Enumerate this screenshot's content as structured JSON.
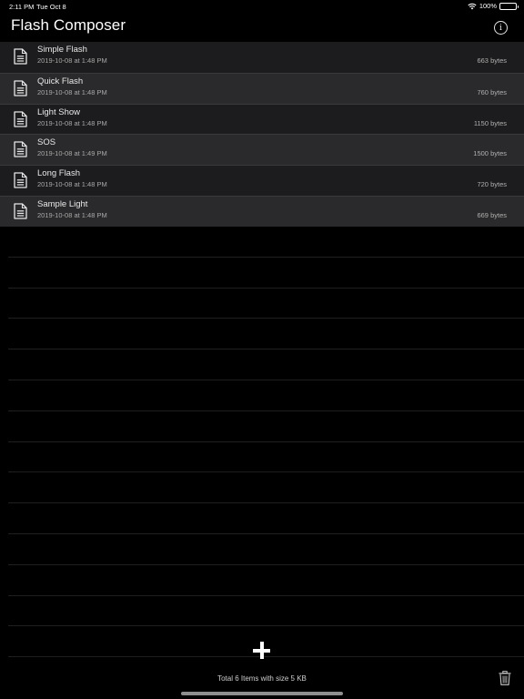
{
  "status_bar": {
    "time": "2:11 PM",
    "date": "Tue Oct 8",
    "battery": "100%"
  },
  "nav": {
    "title": "Flash Composer",
    "info_icon": "info-circle-icon",
    "info_glyph": "i"
  },
  "files": [
    {
      "name": "Simple Flash",
      "date": "2019-10-08 at 1:48 PM",
      "size": "663 bytes"
    },
    {
      "name": "Quick Flash",
      "date": "2019-10-08 at 1:48 PM",
      "size": "760 bytes"
    },
    {
      "name": "Light Show",
      "date": "2019-10-08 at 1:48 PM",
      "size": "1150 bytes"
    },
    {
      "name": "SOS",
      "date": "2019-10-08 at 1:49 PM",
      "size": "1500 bytes"
    },
    {
      "name": "Long Flash",
      "date": "2019-10-08 at 1:48 PM",
      "size": "720 bytes"
    },
    {
      "name": "Sample Light",
      "date": "2019-10-08 at 1:48 PM",
      "size": "669 bytes"
    }
  ],
  "toolbar": {
    "add_icon": "plus-icon",
    "total": "Total 6 Items with size 5 KB",
    "trash_icon": "trash-icon"
  },
  "colors": {
    "background": "#000000",
    "row_odd": "#1c1c1e",
    "row_even": "#2a2a2c",
    "text": "#ffffff"
  }
}
